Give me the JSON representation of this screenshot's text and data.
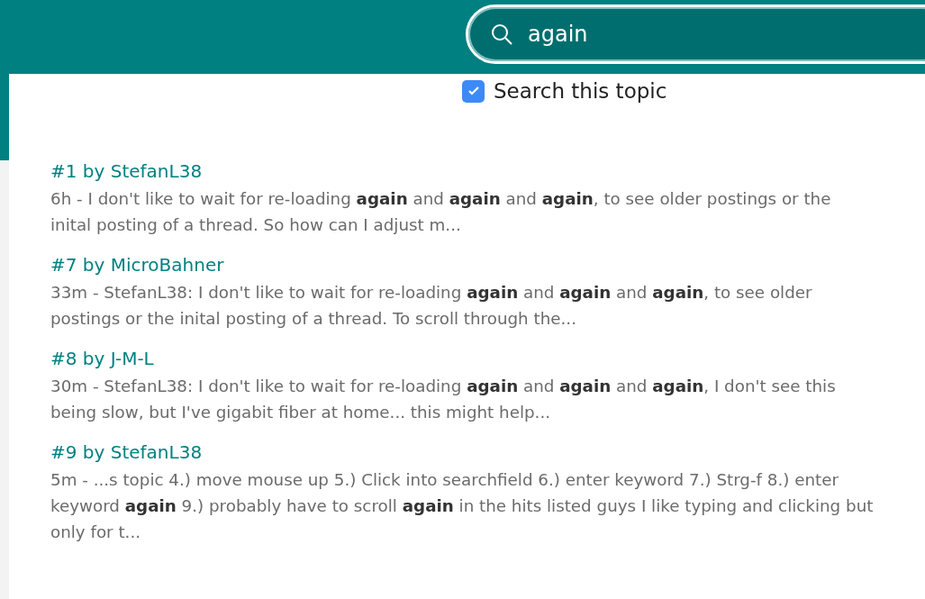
{
  "header": {
    "search": {
      "value": "again"
    }
  },
  "search_options": [
    {
      "label": "Search this topic",
      "checked": true
    }
  ],
  "results": [
    {
      "title": "#1 by StefanL38",
      "snippet": "6h - I don't like to wait for re-loading **again** and **again** and **again**, to see older postings or the inital posting of a thread. So how can I adjust m..."
    },
    {
      "title": "#7 by MicroBahner",
      "snippet": "33m - StefanL38: I don't like to wait for re-loading **again** and **again** and **again**, to see older postings or the inital posting of a thread. To scroll through the..."
    },
    {
      "title": "#8 by J-M-L",
      "snippet": "30m - StefanL38: I don't like to wait for re-loading **again** and **again** and **again**, I don't see this being slow, but I've gigabit fiber at home... this might help..."
    },
    {
      "title": "#9 by StefanL38",
      "snippet": "5m - ...s topic 4.) move mouse up 5.) Click into searchfield 6.) enter keyword 7.) Strg-f 8.) enter keyword **again** 9.) probably have to scroll **again** in the hits listed guys I like typing and clicking but only for t..."
    }
  ]
}
